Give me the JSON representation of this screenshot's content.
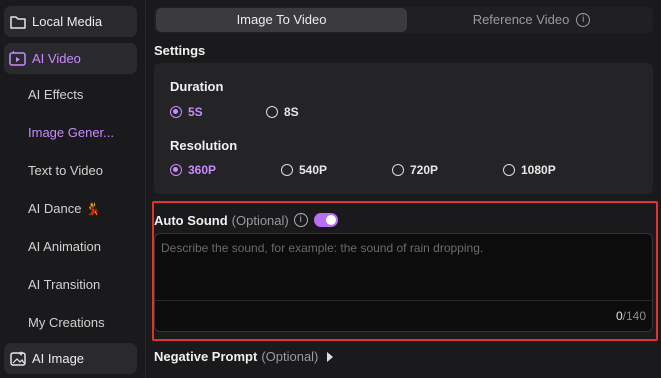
{
  "sidebar": {
    "local_media": "Local Media",
    "ai_video": "AI Video",
    "sub_items": [
      {
        "label": "AI Effects"
      },
      {
        "label": "Image Gener..."
      },
      {
        "label": "Text to Video"
      },
      {
        "label": "AI Dance",
        "emoji": "💃"
      },
      {
        "label": "AI Animation"
      },
      {
        "label": "AI Transition"
      },
      {
        "label": "My Creations"
      }
    ],
    "ai_image": "AI Image",
    "active_sub_index": 1
  },
  "tabs": {
    "image_to_video": "Image To Video",
    "reference_video": "Reference Video",
    "info_glyph": "i"
  },
  "settings": {
    "label": "Settings",
    "duration": {
      "title": "Duration",
      "options": [
        "5S",
        "8S"
      ],
      "selected": "5S"
    },
    "resolution": {
      "title": "Resolution",
      "options": [
        "360P",
        "540P",
        "720P",
        "1080P"
      ],
      "selected": "360P"
    }
  },
  "auto_sound": {
    "title": "Auto Sound",
    "optional": "(Optional)",
    "info_glyph": "i",
    "enabled": true,
    "placeholder": "Describe the sound, for example: the sound of rain dropping.",
    "count": "0",
    "max": "/140"
  },
  "negative_prompt": {
    "title": "Negative Prompt",
    "optional": "(Optional)"
  },
  "colors": {
    "accent": "#c98bff",
    "toggle": "#b86ff5",
    "highlight_border": "#e0342b",
    "background": "#1a1a1c"
  }
}
